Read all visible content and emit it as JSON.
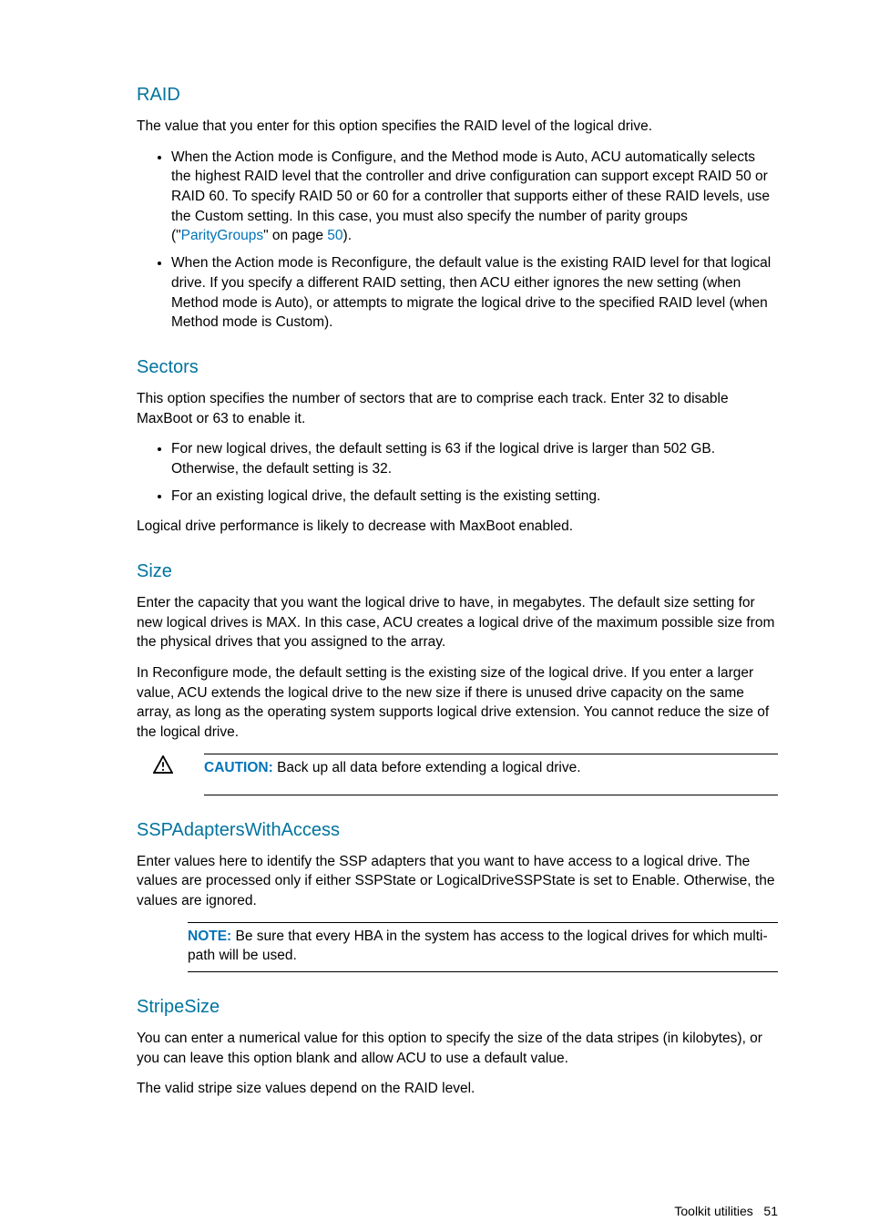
{
  "sections": {
    "raid": {
      "title": "RAID",
      "intro": "The value that you enter for this option specifies the RAID level of the logical drive.",
      "bullet1a": "When the Action mode is Configure, and the Method mode is Auto, ACU automatically selects the highest RAID level that the controller and drive configuration can support except RAID 50 or RAID 60. To specify RAID 50 or 60 for a controller that supports either of these RAID levels, use the Custom setting. In this case, you must also specify the number of parity groups (\"",
      "bullet1_link": "ParityGroups",
      "bullet1b": "\" on page ",
      "bullet1_page": "50",
      "bullet1c": ").",
      "bullet2": "When the Action mode is Reconfigure, the default value is the existing RAID level for that logical drive. If you specify a different RAID setting, then ACU either ignores the new setting (when Method mode is Auto), or attempts to migrate the logical drive to the specified RAID level (when Method mode is Custom)."
    },
    "sectors": {
      "title": "Sectors",
      "intro": "This option specifies the number of sectors that are to comprise each track. Enter 32 to disable MaxBoot or 63 to enable it.",
      "bullet1": "For new logical drives, the default setting is 63 if the logical drive is larger than 502 GB. Otherwise, the default setting is 32.",
      "bullet2": "For an existing logical drive, the default setting is the existing setting.",
      "outro": "Logical drive performance is likely to decrease with MaxBoot enabled."
    },
    "size": {
      "title": "Size",
      "p1": "Enter the capacity that you want the logical drive to have, in megabytes. The default size setting for new logical drives is MAX. In this case, ACU creates a logical drive of the maximum possible size from the physical drives that you assigned to the array.",
      "p2": "In Reconfigure mode, the default setting is the existing size of the logical drive. If you enter a larger value, ACU extends the logical drive to the new size if there is unused drive capacity on the same array, as long as the operating system supports logical drive extension. You cannot reduce the size of the logical drive.",
      "caution_label": "CAUTION:",
      "caution_text": "  Back up all data before extending a logical drive."
    },
    "ssp": {
      "title": "SSPAdaptersWithAccess",
      "p1": "Enter values here to identify the SSP adapters that you want to have access to a logical drive. The values are processed only if either SSPState or LogicalDriveSSPState is set to Enable. Otherwise, the values are ignored.",
      "note_label": "NOTE:",
      "note_text": "  Be sure that every HBA in the system has access to the logical drives for which multi-path will be used."
    },
    "stripe": {
      "title": "StripeSize",
      "p1": "You can enter a numerical value for this option to specify the size of the data stripes (in kilobytes), or you can leave this option blank and allow ACU to use a default value.",
      "p2": "The valid stripe size values depend on the RAID level."
    }
  },
  "footer": {
    "label": "Toolkit utilities",
    "page": "51"
  }
}
